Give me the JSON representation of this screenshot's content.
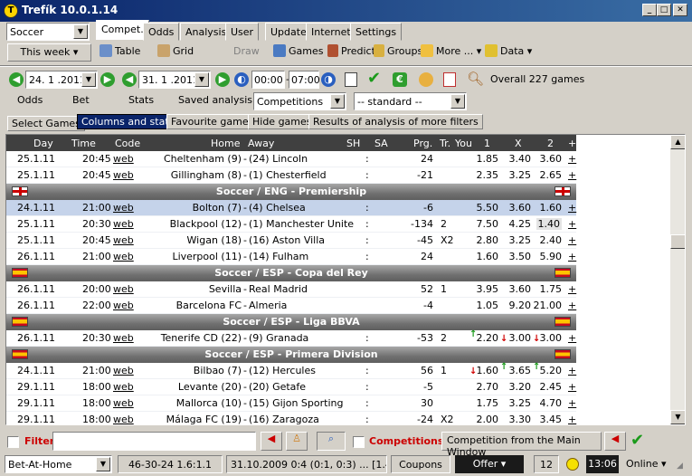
{
  "window": {
    "title": "Trefík 10.0.1.14"
  },
  "sport_select": "Soccer",
  "main_tabs": [
    "Compet.",
    "Odds",
    "Analysis",
    "User",
    "Update",
    "Internet",
    "Settings"
  ],
  "toolbar": {
    "period": "This week",
    "table": "Table",
    "grid": "Grid",
    "draw": "Draw",
    "games": "Games",
    "predict": "Predict",
    "groups": "Groups",
    "more": "More ...",
    "data": "Data"
  },
  "filters": {
    "date_from": "24. 1 .2011",
    "date_to": "31. 1 .2011",
    "time_from": "00:00",
    "time_to": "07:00",
    "overall": "Overall 227 games",
    "odds": "Odds",
    "bet": "Bet",
    "stats": "Stats",
    "saved": "Saved analysis",
    "competitions": "Competitions",
    "standard": "-- standard --"
  },
  "sub_tabs": [
    "Select Games",
    "Columns and stats",
    "Favourite games",
    "Hide games",
    "Results of analysis of more filters"
  ],
  "grid": {
    "headers": {
      "day": "Day",
      "time": "Time",
      "code": "Code",
      "home": "Home",
      "away": "Away",
      "sh": "SH",
      "sa": "SA",
      "prg": "Prg.",
      "tr": "Tr.",
      "you": "You",
      "o1": "1",
      "ox": "X",
      "o2": "2",
      "plus": "+"
    },
    "rows": [
      {
        "type": "game",
        "day": "25.1.11",
        "time": "20:45",
        "code": "web",
        "home": "Cheltenham (9)",
        "away": "(24) Lincoln",
        "colon": ":",
        "prg": "24",
        "tr": "",
        "o1": "1.85",
        "ox": "3.40",
        "o2": "3.60",
        "plus": "+"
      },
      {
        "type": "game",
        "day": "25.1.11",
        "time": "20:45",
        "code": "web",
        "home": "Gillingham (8)",
        "away": "(1) Chesterfield",
        "colon": ":",
        "prg": "-21",
        "tr": "",
        "o1": "2.35",
        "ox": "3.25",
        "o2": "2.65",
        "plus": "+"
      },
      {
        "type": "section",
        "label": "Soccer / ENG - Premiership",
        "flag": "eng"
      },
      {
        "type": "game",
        "day": "24.1.11",
        "time": "21:00",
        "code": "web",
        "home": "Bolton (7)",
        "away": "(4) Chelsea",
        "colon": ":",
        "prg": "-6",
        "tr": "",
        "o1": "5.50",
        "ox": "3.60",
        "o2": "1.60",
        "plus": "+",
        "selected": true
      },
      {
        "type": "game",
        "day": "25.1.11",
        "time": "20:30",
        "code": "web",
        "home": "Blackpool (12)",
        "away": "(1) Manchester Unite",
        "colon": ":",
        "prg": "-134",
        "tr": "2",
        "o1": "7.50",
        "ox": "4.25",
        "o2": "1.40",
        "plus": "+"
      },
      {
        "type": "game",
        "day": "25.1.11",
        "time": "20:45",
        "code": "web",
        "home": "Wigan (18)",
        "away": "(16) Aston Villa",
        "colon": ":",
        "prg": "-45",
        "tr": "X2",
        "o1": "2.80",
        "ox": "3.25",
        "o2": "2.40",
        "plus": "+"
      },
      {
        "type": "game",
        "day": "26.1.11",
        "time": "21:00",
        "code": "web",
        "home": "Liverpool (11)",
        "away": "(14) Fulham",
        "colon": ":",
        "prg": "24",
        "tr": "",
        "o1": "1.60",
        "ox": "3.50",
        "o2": "5.90",
        "plus": "+"
      },
      {
        "type": "section",
        "label": "Soccer / ESP - Copa del Rey",
        "flag": "esp"
      },
      {
        "type": "game",
        "day": "26.1.11",
        "time": "20:00",
        "code": "web",
        "home": "Sevilla",
        "away": "Real Madrid",
        "colon": "",
        "prg": "52",
        "tr": "1",
        "o1": "3.95",
        "ox": "3.60",
        "o2": "1.75",
        "plus": "+"
      },
      {
        "type": "game",
        "day": "26.1.11",
        "time": "22:00",
        "code": "web",
        "home": "Barcelona FC",
        "away": "Almeria",
        "colon": "",
        "prg": "-4",
        "tr": "",
        "o1": "1.05",
        "ox": "9.20",
        "o2": "21.00",
        "plus": "+"
      },
      {
        "type": "section",
        "label": "Soccer / ESP - Liga BBVA",
        "flag": "esp"
      },
      {
        "type": "game",
        "day": "26.1.11",
        "time": "20:30",
        "code": "web",
        "home": "Tenerife CD (22)",
        "away": "(9) Granada",
        "colon": ":",
        "prg": "-53",
        "tr": "2",
        "o1": "2.20",
        "ox": "3.00",
        "o2": "3.00",
        "plus": "+",
        "arrows": [
          "up",
          "down",
          "down"
        ]
      },
      {
        "type": "section",
        "label": "Soccer / ESP - Primera Division",
        "flag": "esp"
      },
      {
        "type": "game",
        "day": "24.1.11",
        "time": "21:00",
        "code": "web",
        "home": "Bilbao (7)",
        "away": "(12) Hercules",
        "colon": ":",
        "prg": "56",
        "tr": "1",
        "o1": "1.60",
        "ox": "3.65",
        "o2": "5.20",
        "plus": "+",
        "arrows": [
          "down",
          "up",
          "up"
        ]
      },
      {
        "type": "game",
        "day": "29.1.11",
        "time": "18:00",
        "code": "web",
        "home": "Levante (20)",
        "away": "(20) Getafe",
        "colon": ":",
        "prg": "-5",
        "tr": "",
        "o1": "2.70",
        "ox": "3.20",
        "o2": "2.45",
        "plus": "+"
      },
      {
        "type": "game",
        "day": "29.1.11",
        "time": "18:00",
        "code": "web",
        "home": "Mallorca (10)",
        "away": "(15) Gijon Sporting",
        "colon": ":",
        "prg": "30",
        "tr": "",
        "o1": "1.75",
        "ox": "3.25",
        "o2": "4.70",
        "plus": "+"
      },
      {
        "type": "game",
        "day": "29.1.11",
        "time": "18:00",
        "code": "web",
        "home": "Málaga FC (19)",
        "away": "(16) Zaragoza",
        "colon": ":",
        "prg": "-24",
        "tr": "X2",
        "o1": "2.00",
        "ox": "3.30",
        "o2": "3.45",
        "plus": "+"
      }
    ]
  },
  "bottom": {
    "filter": "Filter",
    "competitions": "Competitions:",
    "comp_btn": "Competition from the Main Window"
  },
  "status": {
    "bookmaker": "Bet-At-Home",
    "record": "46-30-24  1.6:1.1",
    "info": "31.10.2009 0:4 (0:1, 0:3) ... [1.40]",
    "coupons": "Coupons",
    "offer": "Offer",
    "count": "12",
    "time": "13:06",
    "online": "Online"
  },
  "colors": {
    "title_bar": "#0a246a",
    "section": "#707070",
    "selected_row": "#c5d3ea",
    "filter_red": "#cc0000"
  }
}
